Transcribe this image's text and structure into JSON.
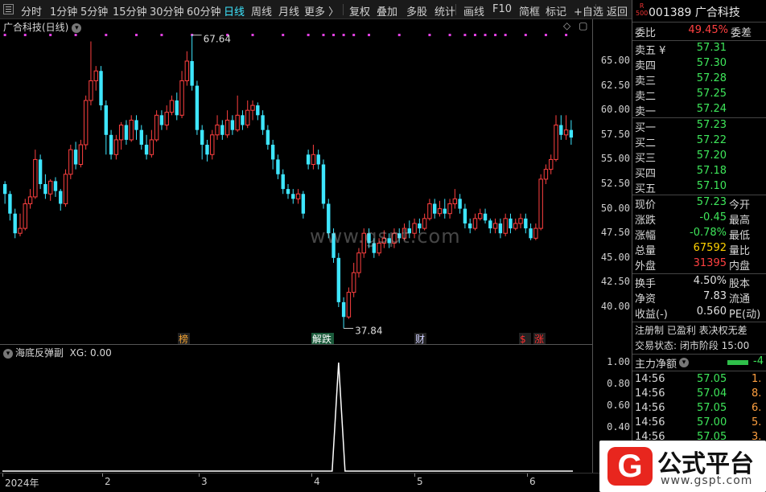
{
  "toolbar": {
    "items": [
      "分时",
      "1分钟",
      "5分钟",
      "15分钟",
      "30分钟",
      "60分钟",
      "日线",
      "周线",
      "月线",
      "更多 〉",
      "复权",
      "叠加",
      "多股",
      "统计",
      "画线",
      "F10",
      "简框",
      "标记",
      "+自选",
      "返回"
    ],
    "active": "日线"
  },
  "chart": {
    "title": "广合科技(日线)",
    "high_label": "67.64",
    "low_label": "37.84",
    "y_ticks": [
      "65.00",
      "62.50",
      "60.00",
      "57.50",
      "55.00",
      "52.50",
      "50.00",
      "47.50",
      "45.00",
      "42.50",
      "40.00"
    ],
    "event_tags": [
      "榜",
      "解跌",
      "财",
      "$",
      "涨"
    ],
    "watermark": "www.gspt.com"
  },
  "indicator": {
    "name": "海底反弹副",
    "value_label": "XG: 0.00",
    "y_ticks": [
      "1.00",
      "0.80",
      "0.60",
      "0.40",
      "0.20"
    ]
  },
  "date_axis": {
    "labels": [
      "2024年",
      "2",
      "3",
      "4",
      "5",
      "6"
    ]
  },
  "side": {
    "badge_top": "R",
    "badge_bottom": "500",
    "stock": "001389 广合科技",
    "ratio_label": "委比",
    "ratio_value": "49.45%",
    "diff_label": "委差",
    "asks": [
      {
        "label": "卖五 ¥",
        "price": "57.31"
      },
      {
        "label": "卖四",
        "price": "57.30"
      },
      {
        "label": "卖三",
        "price": "57.28"
      },
      {
        "label": "卖二",
        "price": "57.25"
      },
      {
        "label": "卖一",
        "price": "57.24"
      }
    ],
    "bids": [
      {
        "label": "买一",
        "price": "57.23"
      },
      {
        "label": "买二",
        "price": "57.22"
      },
      {
        "label": "买三",
        "price": "57.20"
      },
      {
        "label": "买四",
        "price": "57.18"
      },
      {
        "label": "买五",
        "price": "57.10"
      }
    ],
    "quote": [
      {
        "label": "现价",
        "value": "57.23",
        "label2": "今开",
        "color": "green"
      },
      {
        "label": "涨跌",
        "value": "-0.45",
        "label2": "最高",
        "color": "green"
      },
      {
        "label": "涨幅",
        "value": "-0.78%",
        "label2": "最低",
        "color": "green"
      },
      {
        "label": "总量",
        "value": "67592",
        "label2": "量比",
        "color": "yellow"
      },
      {
        "label": "外盘",
        "value": "31395",
        "label2": "内盘",
        "color": "red"
      }
    ],
    "stats": [
      {
        "label": "换手",
        "value": "4.50%",
        "label2": "股本"
      },
      {
        "label": "净资",
        "value": "7.83",
        "label2": "流通"
      },
      {
        "label": "收益(-)",
        "value": "0.560",
        "label2": "PE(动)"
      }
    ],
    "status_line1": "注册制 已盈利 表决权无差",
    "status_line2": "交易状态: 闭市阶段 15:00",
    "main_force_label": "主力净额",
    "main_force_value": "-4",
    "ticks": [
      {
        "time": "14:56",
        "price": "57.05",
        "vol": "1."
      },
      {
        "time": "14:56",
        "price": "57.04",
        "vol": "8."
      },
      {
        "time": "14:56",
        "price": "57.05",
        "vol": "6."
      },
      {
        "time": "14:56",
        "price": "57.00",
        "vol": "5."
      },
      {
        "time": "14:56",
        "price": "57.05",
        "vol": "3."
      }
    ]
  },
  "logo": {
    "g": "G",
    "title": "公式平台",
    "url": "www.gspt.com"
  },
  "colors": {
    "up": "#ff4040",
    "down": "#3ee6ff",
    "magenta": "#e040e0"
  },
  "chart_data": {
    "type": "candlestick",
    "title": "广合科技(日线)",
    "y_range": [
      37.0,
      69.0
    ],
    "max_marker": 67.64,
    "min_marker": 37.84,
    "candles": [
      [
        52.5,
        51.5,
        52.8,
        50.5
      ],
      [
        51.5,
        49.5,
        51.8,
        48.8
      ],
      [
        49.5,
        47.5,
        50.0,
        47.0
      ],
      [
        47.5,
        48.0,
        49.5,
        47.2
      ],
      [
        48.0,
        50.5,
        51.0,
        47.8
      ],
      [
        50.5,
        51.2,
        52.0,
        50.0
      ],
      [
        51.2,
        55.0,
        56.0,
        51.0
      ],
      [
        55.0,
        52.5,
        55.5,
        52.0
      ],
      [
        52.5,
        51.5,
        53.5,
        51.0
      ],
      [
        51.5,
        52.8,
        53.0,
        50.8
      ],
      [
        52.8,
        51.8,
        53.2,
        51.2
      ],
      [
        51.8,
        50.5,
        52.0,
        49.8
      ],
      [
        50.5,
        53.5,
        54.0,
        50.2
      ],
      [
        53.5,
        56.0,
        56.5,
        53.0
      ],
      [
        56.0,
        54.5,
        56.8,
        54.0
      ],
      [
        54.5,
        56.5,
        57.0,
        54.2
      ],
      [
        56.5,
        61.0,
        61.5,
        56.0
      ],
      [
        61.0,
        63.0,
        67.0,
        60.5
      ],
      [
        63.0,
        64.0,
        64.5,
        62.0
      ],
      [
        64.0,
        60.5,
        64.5,
        60.0
      ],
      [
        60.5,
        57.5,
        61.0,
        55.5
      ],
      [
        57.5,
        55.5,
        58.0,
        55.0
      ],
      [
        55.5,
        57.0,
        57.5,
        55.0
      ],
      [
        57.0,
        58.5,
        58.8,
        56.0
      ],
      [
        58.5,
        57.0,
        59.0,
        56.5
      ],
      [
        57.0,
        59.0,
        59.5,
        56.8
      ],
      [
        59.0,
        58.0,
        59.5,
        57.0
      ],
      [
        58.0,
        56.5,
        58.5,
        56.0
      ],
      [
        56.5,
        55.5,
        57.5,
        55.0
      ],
      [
        55.5,
        57.0,
        58.0,
        55.2
      ],
      [
        57.0,
        59.5,
        60.0,
        56.8
      ],
      [
        59.5,
        58.5,
        60.0,
        58.0
      ],
      [
        58.5,
        59.8,
        60.5,
        58.0
      ],
      [
        59.8,
        61.0,
        61.5,
        59.5
      ],
      [
        61.0,
        59.5,
        61.8,
        59.0
      ],
      [
        59.5,
        63.0,
        64.0,
        59.2
      ],
      [
        63.0,
        65.0,
        66.0,
        62.5
      ],
      [
        65.0,
        62.5,
        67.64,
        62.0
      ],
      [
        62.5,
        58.0,
        63.0,
        57.5
      ],
      [
        58.0,
        56.5,
        58.5,
        55.0
      ],
      [
        56.5,
        55.5,
        57.0,
        54.8
      ],
      [
        55.5,
        57.5,
        58.0,
        55.0
      ],
      [
        57.5,
        58.5,
        59.5,
        57.0
      ],
      [
        58.5,
        57.5,
        59.0,
        57.0
      ],
      [
        57.5,
        59.0,
        60.0,
        57.2
      ],
      [
        59.0,
        58.0,
        59.5,
        57.5
      ],
      [
        58.0,
        59.5,
        61.5,
        57.8
      ],
      [
        59.5,
        58.5,
        60.0,
        58.0
      ],
      [
        58.5,
        60.0,
        61.0,
        58.2
      ],
      [
        60.0,
        60.5,
        61.0,
        59.0
      ],
      [
        60.5,
        59.5,
        60.8,
        59.0
      ],
      [
        59.5,
        58.0,
        60.0,
        57.5
      ],
      [
        58.0,
        56.5,
        58.5,
        56.0
      ],
      [
        56.5,
        55.0,
        57.0,
        54.0
      ],
      [
        55.0,
        53.5,
        55.5,
        53.0
      ],
      [
        53.5,
        52.0,
        54.0,
        51.5
      ],
      [
        52.0,
        51.5,
        52.5,
        51.0
      ],
      [
        51.5,
        51.0,
        52.0,
        50.5
      ],
      [
        51.0,
        51.5,
        52.0,
        50.5
      ],
      [
        51.5,
        49.5,
        51.8,
        49.0
      ],
      [
        55.5,
        54.5,
        56.0,
        54.0
      ],
      [
        54.5,
        55.5,
        56.5,
        54.0
      ],
      [
        55.5,
        54.5,
        56.0,
        54.0
      ],
      [
        54.5,
        50.5,
        55.0,
        50.0
      ],
      [
        50.5,
        47.5,
        51.0,
        47.0
      ],
      [
        47.5,
        45.0,
        48.0,
        44.5
      ],
      [
        45.0,
        40.5,
        45.5,
        40.0
      ],
      [
        40.5,
        39.0,
        41.0,
        37.84
      ],
      [
        39.0,
        41.5,
        42.0,
        38.8
      ],
      [
        41.5,
        43.5,
        44.5,
        41.0
      ],
      [
        43.5,
        45.5,
        46.0,
        43.0
      ],
      [
        45.5,
        47.5,
        48.0,
        45.0
      ],
      [
        47.5,
        46.5,
        48.0,
        46.0
      ],
      [
        46.5,
        45.5,
        47.0,
        45.0
      ],
      [
        45.5,
        46.5,
        47.0,
        45.2
      ],
      [
        46.5,
        47.0,
        47.8,
        46.0
      ],
      [
        47.0,
        46.5,
        47.5,
        46.0
      ],
      [
        46.5,
        47.5,
        48.0,
        46.0
      ],
      [
        47.5,
        47.0,
        48.0,
        46.5
      ],
      [
        47.0,
        48.0,
        48.5,
        46.8
      ],
      [
        48.0,
        47.5,
        48.8,
        47.0
      ],
      [
        47.5,
        48.5,
        49.0,
        47.0
      ],
      [
        48.5,
        48.0,
        49.0,
        47.5
      ],
      [
        48.0,
        49.0,
        49.5,
        47.8
      ],
      [
        49.0,
        50.5,
        51.0,
        48.8
      ],
      [
        50.5,
        49.5,
        51.0,
        49.0
      ],
      [
        49.5,
        50.0,
        50.8,
        49.2
      ],
      [
        50.0,
        49.5,
        51.0,
        49.0
      ],
      [
        49.5,
        50.5,
        51.0,
        49.0
      ],
      [
        50.5,
        51.0,
        52.0,
        50.0
      ],
      [
        51.0,
        50.0,
        51.5,
        49.5
      ],
      [
        50.0,
        48.5,
        50.5,
        48.0
      ],
      [
        48.5,
        48.0,
        49.0,
        47.5
      ],
      [
        48.0,
        49.0,
        49.5,
        47.8
      ],
      [
        49.0,
        49.5,
        50.0,
        48.8
      ],
      [
        49.5,
        48.8,
        50.0,
        48.5
      ],
      [
        48.8,
        48.0,
        49.0,
        47.5
      ],
      [
        48.0,
        48.5,
        49.0,
        47.5
      ],
      [
        48.5,
        47.5,
        49.0,
        47.0
      ],
      [
        47.5,
        49.0,
        49.5,
        47.2
      ],
      [
        49.0,
        48.0,
        49.5,
        47.5
      ],
      [
        48.0,
        48.5,
        49.0,
        47.8
      ],
      [
        48.5,
        49.0,
        49.5,
        48.0
      ],
      [
        49.0,
        48.0,
        49.5,
        47.5
      ],
      [
        48.0,
        47.0,
        48.5,
        46.8
      ],
      [
        47.0,
        48.0,
        48.5,
        46.8
      ],
      [
        48.0,
        53.0,
        53.5,
        47.8
      ],
      [
        53.0,
        54.0,
        54.5,
        52.5
      ],
      [
        54.0,
        55.0,
        55.5,
        53.5
      ],
      [
        55.0,
        58.5,
        59.5,
        54.8
      ],
      [
        58.5,
        57.5,
        59.5,
        57.0
      ],
      [
        57.5,
        58.0,
        59.5,
        57.0
      ],
      [
        58.0,
        57.23,
        59.0,
        56.5
      ]
    ],
    "indicator_series": {
      "name": "XG",
      "spike_index": 66,
      "spike_value": 1.0,
      "baseline": 0.0,
      "y_range": [
        0,
        1.05
      ]
    }
  }
}
